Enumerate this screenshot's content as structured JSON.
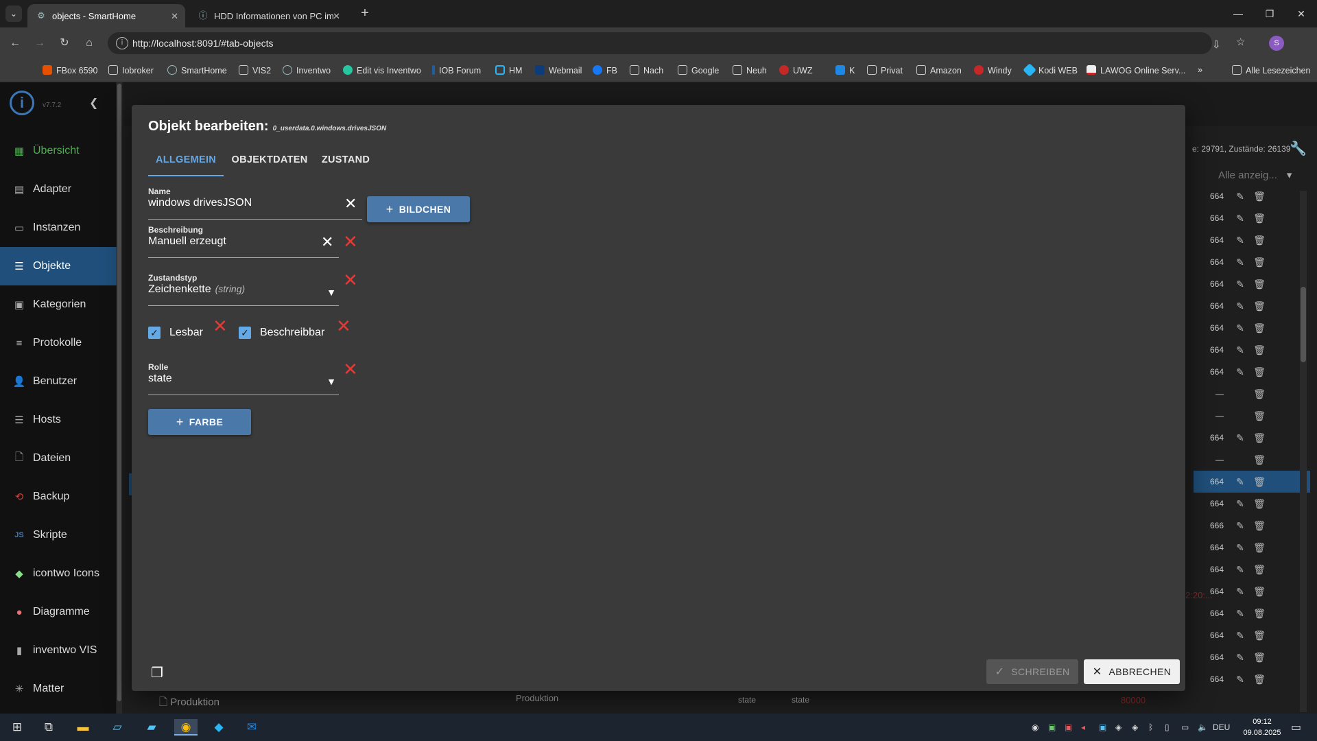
{
  "browser": {
    "tabs": [
      {
        "title": "objects - SmartHome",
        "icon": "gear-icon"
      },
      {
        "title": "HDD Informationen von PC im ...",
        "icon": "iobroker-icon"
      }
    ],
    "url": "http://localhost:8091/#tab-objects",
    "profile_initial": "S",
    "bookmarks": [
      "FBox 6590",
      "Iobroker",
      "SmartHome",
      "VIS2",
      "Inventwo",
      "Edit vis Inventwo",
      "IOB Forum",
      "HM",
      "Webmail",
      "FB",
      "Nach",
      "Google",
      "Neuh",
      "UWZ",
      "K",
      "Privat",
      "Amazon",
      "Windy",
      "Kodi WEB",
      "LAWOG Online Serv..."
    ],
    "all_bookmarks": "Alle Lesezeichen"
  },
  "app": {
    "version": "v7.7.2",
    "nav": [
      "Übersicht",
      "Adapter",
      "Instanzen",
      "Objekte",
      "Kategorien",
      "Protokolle",
      "Benutzer",
      "Hosts",
      "Dateien",
      "Backup",
      "Skripte",
      "icontwo Icons",
      "Diagramme",
      "inventwo VIS",
      "Matter"
    ],
    "active_nav": "Objekte",
    "status_text": "e: 29791, Zustände: 26139",
    "filter_placeholder": "Alle anzeig...",
    "bg_values": [
      "664",
      "664",
      "664",
      "664",
      "664",
      "664",
      "664",
      "664",
      "664",
      "—",
      "—",
      "664",
      "—",
      "664",
      "664",
      "666",
      "664",
      "664",
      "664",
      "664",
      "664",
      "664",
      "664",
      "664"
    ],
    "bg_bottom": {
      "name": "Produktion",
      "desc": "Produktion",
      "role1": "state",
      "role2": "state",
      "value": "80000",
      "time_fragment": "2:20:..."
    }
  },
  "dialog": {
    "title": "Objekt bearbeiten:",
    "object_id": "0_userdata.0.windows.drivesJSON",
    "tabs": [
      "ALLGEMEIN",
      "OBJEKTDATEN",
      "ZUSTAND"
    ],
    "active_tab": "ALLGEMEIN",
    "name_label": "Name",
    "name_value": "windows drivesJSON",
    "image_button": "BILDCHEN",
    "description_label": "Beschreibung",
    "description_value": "Manuell erzeugt",
    "state_type_label": "Zustandstyp",
    "state_type_value": "Zeichenkette",
    "state_type_hint": "(string)",
    "readable_label": "Lesbar",
    "readable_checked": true,
    "writable_label": "Beschreibbar",
    "writable_checked": true,
    "role_label": "Rolle",
    "role_value": "state",
    "color_button": "FARBE",
    "write_button": "SCHREIBEN",
    "cancel_button": "ABBRECHEN"
  },
  "taskbar": {
    "language": "DEU",
    "time": "09:12",
    "date": "09.08.2025"
  }
}
